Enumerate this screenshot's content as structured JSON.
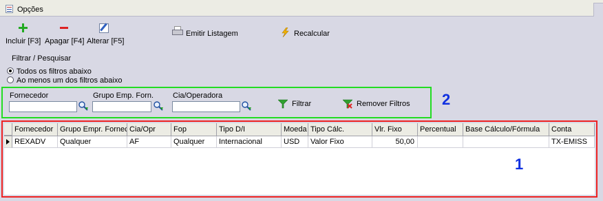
{
  "tab": {
    "label": "Opções",
    "icon": "document-icon"
  },
  "toolbar": {
    "incluir": {
      "label": "Incluir [F3]",
      "icon": "plus-icon",
      "color": "#22aa22"
    },
    "apagar": {
      "label": "Apagar [F4]",
      "icon": "minus-icon",
      "color": "#dd2222"
    },
    "alterar": {
      "label": "Alterar [F5]",
      "icon": "edit-icon"
    },
    "emitir": {
      "label": "Emitir Listagem",
      "icon": "printer-icon"
    },
    "recalcular": {
      "label": "Recalcular",
      "icon": "lightning-icon"
    }
  },
  "filter": {
    "title": "Filtrar / Pesquisar",
    "mode_all": "Todos os filtros abaixo",
    "mode_any": "Ao menos um dos filtros abaixo",
    "selected_mode": "all",
    "fornecedor": {
      "label": "Fornecedor",
      "value": ""
    },
    "grupo": {
      "label": "Grupo Emp. Forn.",
      "value": ""
    },
    "cia": {
      "label": "Cia/Operadora",
      "value": ""
    },
    "filtrar_label": "Filtrar",
    "remover_label": "Remover Filtros"
  },
  "callouts": {
    "grid": "1",
    "filters": "2",
    "grid_box_color": "#ee2222",
    "filters_box_color": "#22dd22",
    "text_color": "#1030e0"
  },
  "grid": {
    "columns": [
      "Fornecedor",
      "Grupo Empr. Fornec.",
      "Cia/Opr",
      "Fop",
      "Tipo D/I",
      "Moeda",
      "Tipo Cálc.",
      "Vlr. Fixo",
      "Percentual",
      "Base Cálculo/Fórmula",
      "Conta"
    ],
    "rows": [
      [
        "REXADV",
        "Qualquer",
        "AF",
        "Qualquer",
        "Internacional",
        "USD",
        "Valor Fixo",
        "50,00",
        "",
        "",
        "TX-EMISS"
      ]
    ]
  }
}
